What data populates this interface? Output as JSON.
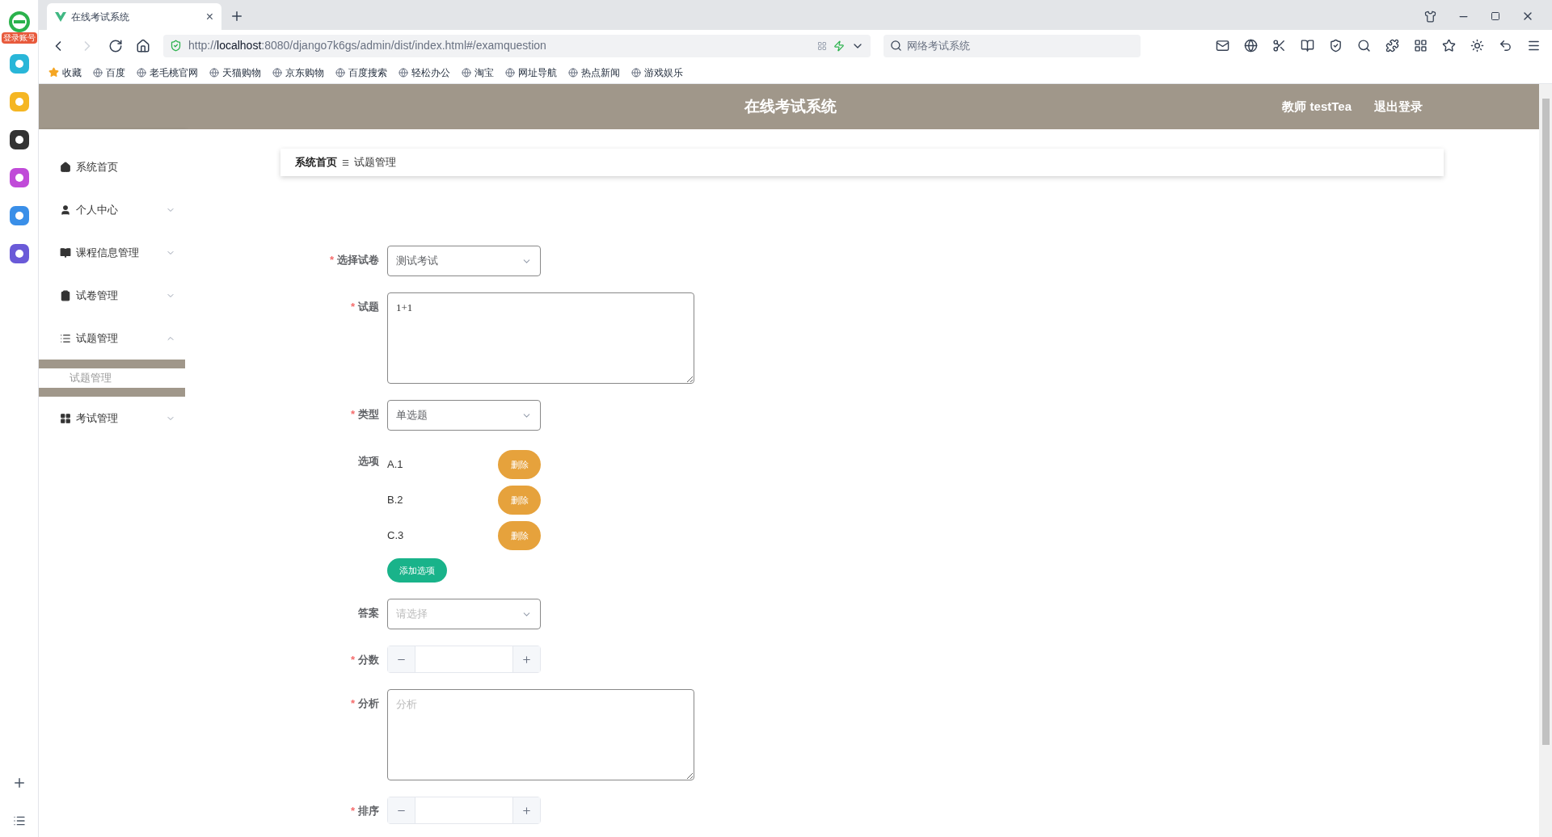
{
  "browser": {
    "account_badge": "登录账号",
    "tab": {
      "title": "在线考试系统",
      "close": "×"
    },
    "url": {
      "prefix": "http://",
      "host": "localhost",
      "rest": ":8080/django7k6gs/admin/dist/index.html#/examquestion"
    },
    "search": {
      "placeholder": "网络考试系统"
    },
    "bookmarks": [
      "收藏",
      "百度",
      "老毛桃官网",
      "天猫购物",
      "京东购物",
      "百度搜索",
      "轻松办公",
      "淘宝",
      "网址导航",
      "热点新闻",
      "游戏娱乐"
    ]
  },
  "header": {
    "title": "在线考试系统",
    "user": "教师 testTea",
    "logout": "退出登录"
  },
  "sidebar": {
    "items": [
      {
        "label": "系统首页"
      },
      {
        "label": "个人中心",
        "expandable": true,
        "expanded": false
      },
      {
        "label": "课程信息管理",
        "expandable": true,
        "expanded": false
      },
      {
        "label": "试卷管理",
        "expandable": true,
        "expanded": false
      },
      {
        "label": "试题管理",
        "expandable": true,
        "expanded": true,
        "children": [
          {
            "label": "试题管理",
            "selected": true
          }
        ]
      },
      {
        "label": "考试管理",
        "expandable": true,
        "expanded": false
      }
    ]
  },
  "breadcrumb": {
    "items": [
      "系统首页",
      "试题管理"
    ],
    "separator": "☰"
  },
  "form": {
    "required_mark": "*",
    "fields": [
      {
        "kind": "select",
        "label": "选择试卷",
        "required": true,
        "value": "测试考试"
      },
      {
        "kind": "textarea",
        "label": "试题",
        "required": true,
        "value": "1+1"
      },
      {
        "kind": "select",
        "label": "类型",
        "required": true,
        "value": "单选题"
      },
      {
        "kind": "options",
        "label": "选项",
        "required": false,
        "add_button": "添加选项",
        "options": [
          {
            "text": "A.1",
            "button": "删除"
          },
          {
            "text": "B.2",
            "button": "删除"
          },
          {
            "text": "C.3",
            "button": "删除"
          }
        ]
      },
      {
        "kind": "select",
        "label": "答案",
        "required": false,
        "placeholder": "请选择"
      },
      {
        "kind": "number",
        "label": "分数",
        "required": true
      },
      {
        "kind": "textarea",
        "label": "分析",
        "required": true,
        "placeholder": "分析"
      },
      {
        "kind": "number",
        "label": "排序",
        "required": true
      }
    ]
  }
}
